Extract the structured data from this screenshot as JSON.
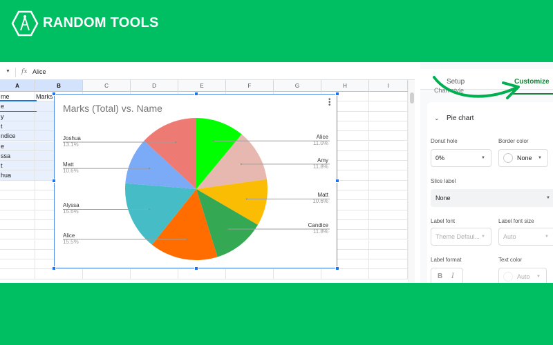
{
  "brand": {
    "name": "RANDOM TOOLS",
    "logo_icon": "compass-hexagon-icon",
    "color": "#00bf63"
  },
  "formula_bar": {
    "fx_label": "fx",
    "value": "Alice"
  },
  "columns": [
    "A",
    "B",
    "C",
    "D",
    "E",
    "F",
    "G",
    "H",
    "I"
  ],
  "cells": {
    "header_row": [
      "me",
      "Marks"
    ],
    "names": [
      "e",
      "y",
      "t",
      "ndice",
      "e",
      "ssa",
      "t",
      "hua"
    ]
  },
  "chart_data": {
    "type": "pie",
    "title": "Marks (Total) vs. Name",
    "categories": [
      "Alice",
      "Amy",
      "Matt",
      "Candice",
      "Alice",
      "Alyssa",
      "Matt",
      "Joshua"
    ],
    "values": [
      11.0,
      11.8,
      10.6,
      11.8,
      15.5,
      15.6,
      10.6,
      13.1
    ],
    "labels": [
      "11.0%",
      "11.8%",
      "10.6%",
      "11.8%",
      "15.5%",
      "15.6%",
      "10.6%",
      "13.1%"
    ],
    "colors": [
      "#00ff00",
      "#e6b8af",
      "#fbbc04",
      "#34a853",
      "#ff6d01",
      "#46bdc6",
      "#7baaf7",
      "#ee7b73"
    ],
    "legend": "labeled-slices",
    "start": "top",
    "direction": "clockwise"
  },
  "panel": {
    "tabs": [
      "Setup",
      "Customize"
    ],
    "active_tab": "Customize",
    "chart_style": "Chart style",
    "section": "Pie chart",
    "donut_hole": {
      "label": "Donut hole",
      "value": "0%"
    },
    "border_color": {
      "label": "Border color",
      "value": "None"
    },
    "slice_label": {
      "label": "Slice label",
      "value": "None"
    },
    "label_font": {
      "label": "Label font",
      "value": "Theme Defaul..."
    },
    "label_font_size": {
      "label": "Label font size",
      "value": "Auto"
    },
    "label_format": {
      "label": "Label format",
      "bold": "B",
      "italic": "I"
    },
    "text_color": {
      "label": "Text color",
      "value": "Auto"
    }
  }
}
